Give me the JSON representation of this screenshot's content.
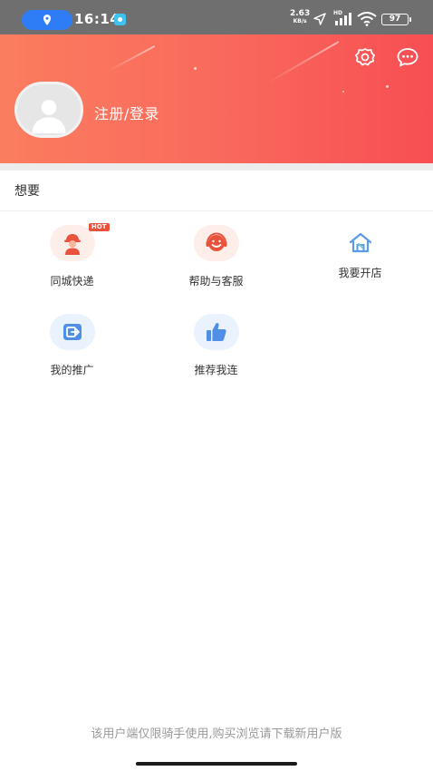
{
  "status_bar": {
    "time": "16:14",
    "net_speed_value": "2.63",
    "net_speed_unit": "KB/s",
    "signal_label": "HD",
    "battery": "97"
  },
  "header": {
    "login_text": "注册/登录"
  },
  "section": {
    "title": "想要"
  },
  "grid": {
    "items": [
      {
        "label": "同城快递",
        "icon": "courier-icon",
        "badge": "HOT",
        "color": "#e9533e"
      },
      {
        "label": "帮助与客服",
        "icon": "customer-service-icon",
        "color": "#e9533e"
      },
      {
        "label": "我要开店",
        "icon": "shop-house-icon",
        "color": "#5b9ae8"
      },
      {
        "label": "我的推广",
        "icon": "share-icon",
        "color": "#4f8fe6"
      },
      {
        "label": "推荐我连",
        "icon": "thumbs-up-icon",
        "color": "#4f8fe6"
      }
    ]
  },
  "footer": {
    "note": "该用户端仅限骑手使用,购买浏览请下载新用户版"
  },
  "colors": {
    "header_start": "#fb7d5f",
    "header_end": "#f84e53",
    "accent_red": "#e9533e",
    "accent_blue": "#4f8fe6"
  }
}
